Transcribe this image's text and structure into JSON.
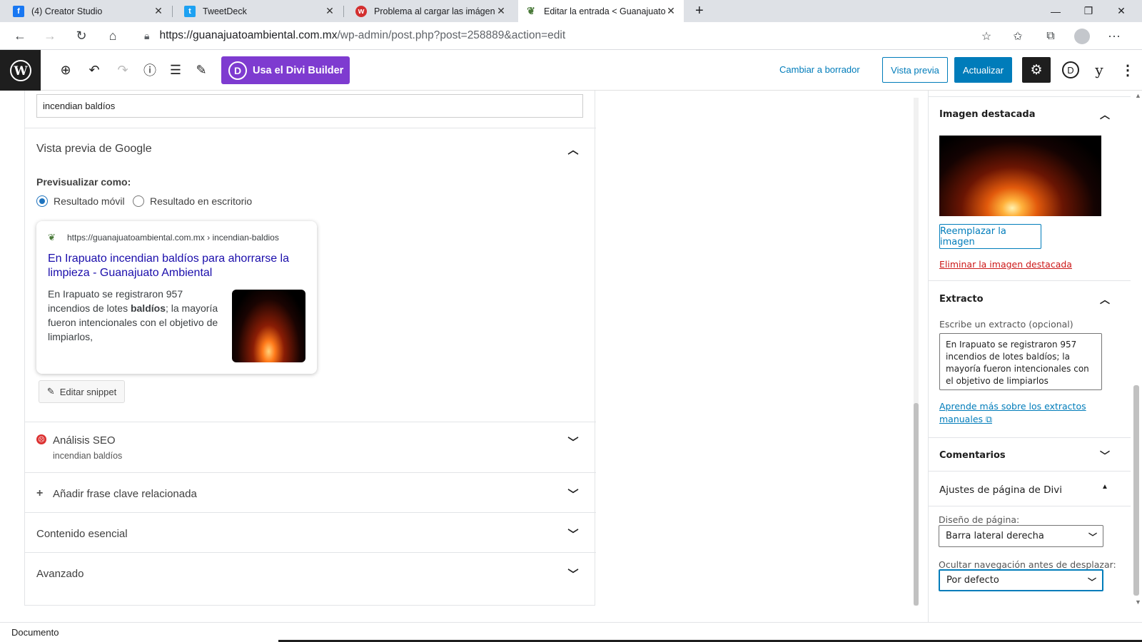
{
  "browser": {
    "tabs": [
      {
        "title": "(4) Creator Studio",
        "icon": "facebook-icon",
        "color": "#1877f2"
      },
      {
        "title": "TweetDeck",
        "icon": "twitter-icon",
        "color": "#1da1f2"
      },
      {
        "title": "Problema al cargar las imágenes",
        "icon": "wpforo-icon",
        "color": "#d32f2f"
      },
      {
        "title": "Editar la entrada < Guanajuato A",
        "icon": "site-favicon",
        "color": "#4a7a3a"
      }
    ],
    "url_host": "https://guanajuatoambiental.com.mx",
    "url_path": "/wp-admin/post.php?post=258889&action=edit"
  },
  "toolbar": {
    "divi_label": "Usa el Divi Builder",
    "draft_label": "Cambiar a borrador",
    "preview_label": "Vista previa",
    "update_label": "Actualizar"
  },
  "seo": {
    "focus_keyword": "incendian baldíos",
    "google_preview_title": "Vista previa de Google",
    "preview_as_label": "Previsualizar como:",
    "radio_mobile": "Resultado móvil",
    "radio_desktop": "Resultado en escritorio",
    "snippet": {
      "url": "https://guanajuatoambiental.com.mx › incendian-baldios",
      "title": "En Irapuato incendian baldíos para ahorrarse la limpieza - Guanajuato Ambiental",
      "desc_before": "En Irapuato se registraron 957 incendios de lotes ",
      "desc_bold": "baldíos",
      "desc_after": "; la mayoría fueron intencionales con el objetivo de limpiarlos,"
    },
    "edit_snippet_label": "Editar snippet",
    "analysis_title": "Análisis SEO",
    "analysis_sub": "incendian baldíos",
    "add_keyphrase": "Añadir frase clave relacionada",
    "cornerstone": "Contenido esencial",
    "advanced": "Avanzado"
  },
  "sidebar": {
    "featured_title": "Imagen destacada",
    "replace_label": "Reemplazar la imagen",
    "remove_label": "Eliminar la imagen destacada",
    "excerpt_title": "Extracto",
    "excerpt_label": "Escribe un extracto (opcional)",
    "excerpt_text": "En Irapuato se registraron 957 incendios de lotes baldíos; la mayoría fueron intencionales con el objetivo de limpiarlos",
    "excerpt_link": "Aprende más sobre los extractos manuales",
    "comments_title": "Comentarios",
    "divi_title": "Ajustes de página de Divi",
    "layout_label": "Diseño de página:",
    "layout_value": "Barra lateral derecha",
    "hide_nav_label": "Ocultar navegación antes de desplazar:",
    "hide_nav_value": "Por defecto"
  },
  "status": {
    "breadcrumb": "Documento"
  },
  "colors": {
    "wp_blue": "#007cba",
    "divi_purple": "#7e3bd0",
    "error_red": "#cc1818"
  }
}
